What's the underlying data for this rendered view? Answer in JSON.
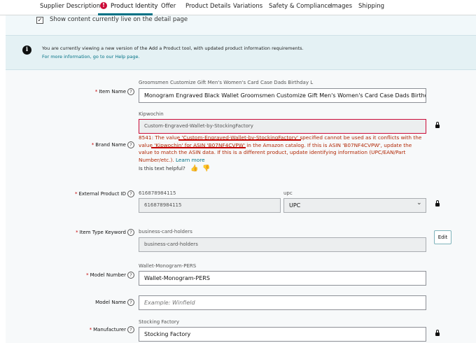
{
  "tabs": [
    {
      "label": "Supplier Description"
    },
    {
      "label": "Product Identity"
    },
    {
      "label": "Offer"
    },
    {
      "label": "Product Details"
    },
    {
      "label": "Variations"
    },
    {
      "label": "Safety & Compliance"
    },
    {
      "label": "Images"
    },
    {
      "label": "Shipping"
    }
  ],
  "show_content_label": "Show content currently live on the detail page",
  "notice": {
    "text": "You are currently viewing a new version of the Add a Product tool, with updated product information requirements.",
    "link": "For more information, go to our Help page."
  },
  "fields": {
    "item_name": {
      "label": "Item Name",
      "hint": "Groomsmen Customize Gift Men's Women's Card Case Dads Birthday L",
      "value": "Monogram Engraved Black Wallet Groomsmen Customize Gift Men's Women's Card Case Dads Birthd"
    },
    "brand_name": {
      "label": "Brand Name",
      "hint": "Kipwochin",
      "value": "Custom-Engraved-Wallet-by-StockingFactory",
      "error": "8541: The value 'Custom-Engraved-Wallet-by-StockingFactory' specified cannot be used as it conflicts with the value 'Kipwochin' for ASIN 'B07NF4CVPW' in the Amazon catalog. If this is ASIN 'B07NF4CVPW', update the value to match the ASIN data. If this is a different product, update identifying information (UPC/EAN/Part Number/etc.).",
      "learn_more": "Learn more",
      "helpful": "Is this text helpful?"
    },
    "external_product_id": {
      "label": "External Product ID",
      "hint": "616878984115",
      "value": "616878984115",
      "type_hint": "upc",
      "type_value": "UPC"
    },
    "item_type_keyword": {
      "label": "Item Type Keyword",
      "hint": "business-card-holders",
      "value": "business-card-holders",
      "edit_label": "Edit"
    },
    "model_number": {
      "label": "Model Number",
      "hint": "Wallet-Monogram-PERS",
      "value": "Wallet-Monogram-PERS"
    },
    "model_name": {
      "label": "Model Name",
      "placeholder": "Example: Winfield"
    },
    "manufacturer": {
      "label": "Manufacturer",
      "hint": "Stocking Factory",
      "value": "Stocking Factory"
    }
  },
  "icons": {
    "help": "?",
    "info": "i",
    "error": "!",
    "check": "✓",
    "thumbs_up": "👍",
    "thumbs_down": "👎",
    "chevron": "⌄"
  },
  "colors": {
    "accent": "#007185",
    "error": "#cc0c39",
    "error_text": "#b12704",
    "panel": "#f7f9fa"
  }
}
